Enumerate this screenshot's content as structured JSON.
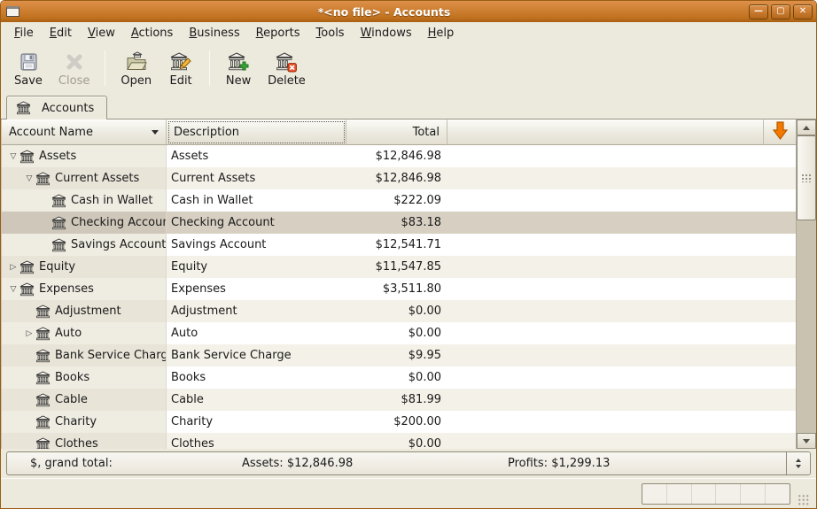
{
  "window": {
    "title": "*<no file> - Accounts"
  },
  "titlebar": {
    "buttons": [
      {
        "name": "minimize",
        "glyph": "–"
      },
      {
        "name": "maximize",
        "glyph": "❐"
      },
      {
        "name": "close",
        "glyph": "✕"
      }
    ]
  },
  "menubar": {
    "items": [
      {
        "label": "File",
        "accel": "F"
      },
      {
        "label": "Edit",
        "accel": "E"
      },
      {
        "label": "View",
        "accel": "V"
      },
      {
        "label": "Actions",
        "accel": "A"
      },
      {
        "label": "Business",
        "accel": "B"
      },
      {
        "label": "Reports",
        "accel": "R"
      },
      {
        "label": "Tools",
        "accel": "T"
      },
      {
        "label": "Windows",
        "accel": "W"
      },
      {
        "label": "Help",
        "accel": "H"
      }
    ]
  },
  "toolbar": {
    "buttons": [
      {
        "label": "Save",
        "icon": "save-floppy-icon",
        "enabled": true
      },
      {
        "label": "Close",
        "icon": "close-x-icon",
        "enabled": false
      },
      {
        "separator": true
      },
      {
        "label": "Open",
        "icon": "open-folder-icon",
        "enabled": true
      },
      {
        "label": "Edit",
        "icon": "edit-account-icon",
        "enabled": true
      },
      {
        "separator": true
      },
      {
        "label": "New",
        "icon": "new-account-icon",
        "enabled": true
      },
      {
        "label": "Delete",
        "icon": "delete-account-icon",
        "enabled": true
      }
    ]
  },
  "tabs": [
    {
      "label": "Accounts",
      "icon": "bank-icon",
      "active": true
    }
  ],
  "table": {
    "columns": [
      {
        "label": "Account Name",
        "sorted": true
      },
      {
        "label": "Description",
        "focused": true
      },
      {
        "label": "Total",
        "align": "right"
      }
    ],
    "rows": [
      {
        "level": 0,
        "expander": "open",
        "name": "Assets",
        "description": "Assets",
        "total": "$12,846.98",
        "selected": false
      },
      {
        "level": 1,
        "expander": "open",
        "name": "Current Assets",
        "description": "Current Assets",
        "total": "$12,846.98",
        "selected": false
      },
      {
        "level": 2,
        "expander": "none",
        "name": "Cash in Wallet",
        "description": "Cash in Wallet",
        "total": "$222.09",
        "selected": false
      },
      {
        "level": 2,
        "expander": "none",
        "name": "Checking Account",
        "description": "Checking Account",
        "total": "$83.18",
        "selected": true
      },
      {
        "level": 2,
        "expander": "none",
        "name": "Savings Account",
        "description": "Savings Account",
        "total": "$12,541.71",
        "selected": false
      },
      {
        "level": 0,
        "expander": "closed",
        "name": "Equity",
        "description": "Equity",
        "total": "$11,547.85",
        "selected": false
      },
      {
        "level": 0,
        "expander": "open",
        "name": "Expenses",
        "description": "Expenses",
        "total": "$3,511.80",
        "selected": false
      },
      {
        "level": 1,
        "expander": "none",
        "name": "Adjustment",
        "description": "Adjustment",
        "total": "$0.00",
        "selected": false
      },
      {
        "level": 1,
        "expander": "closed",
        "name": "Auto",
        "description": "Auto",
        "total": "$0.00",
        "selected": false
      },
      {
        "level": 1,
        "expander": "none",
        "name": "Bank Service Charge",
        "description": "Bank Service Charge",
        "total": "$9.95",
        "selected": false
      },
      {
        "level": 1,
        "expander": "none",
        "name": "Books",
        "description": "Books",
        "total": "$0.00",
        "selected": false
      },
      {
        "level": 1,
        "expander": "none",
        "name": "Cable",
        "description": "Cable",
        "total": "$81.99",
        "selected": false
      },
      {
        "level": 1,
        "expander": "none",
        "name": "Charity",
        "description": "Charity",
        "total": "$200.00",
        "selected": false
      },
      {
        "level": 1,
        "expander": "none",
        "name": "Clothes",
        "description": "Clothes",
        "total": "$0.00",
        "selected": false
      }
    ]
  },
  "summary_bar": {
    "label": "$, grand total:",
    "assets": "Assets: $12,846.98",
    "profits": "Profits: $1,299.13"
  },
  "statusbar": {
    "progress_segments": 6
  },
  "colors": {
    "accent_orange": "#f57900",
    "titlebar_orange": "#c1721f",
    "selected_row": "#d7cfc2",
    "row_alt": "#f4f1e8",
    "window_bg": "#ece9dd"
  }
}
